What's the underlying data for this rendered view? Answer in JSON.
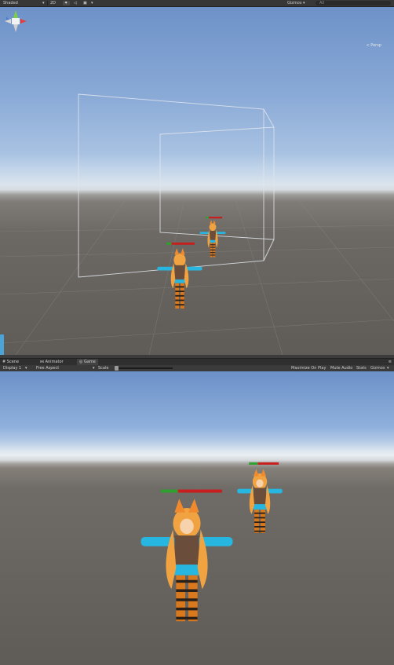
{
  "scene": {
    "toolbar": {
      "shading_mode": "Shaded",
      "mode_2d": "2D",
      "gizmos_label": "Gizmos",
      "search_placeholder": "All"
    },
    "gizmo_label": "< Persp"
  },
  "tabs": [
    {
      "label": "Scene",
      "icon": "hash-icon"
    },
    {
      "label": "Animator",
      "icon": "animator-icon"
    },
    {
      "label": "Game",
      "icon": "game-icon",
      "active": true
    }
  ],
  "game": {
    "toolbar": {
      "display": "Display 1",
      "aspect": "Free Aspect",
      "scale_label": "Scale",
      "toggles": [
        "Maximize On Play",
        "Mute Audio",
        "Stats",
        "Gizmos"
      ]
    },
    "health": {
      "near_character": 0.28,
      "far_character": 0.3
    }
  },
  "colors": {
    "health_fill": "#2ea02e",
    "health_empty": "#c81e1e",
    "sleeves": "#27b6e0",
    "hair": "#f0a340"
  }
}
